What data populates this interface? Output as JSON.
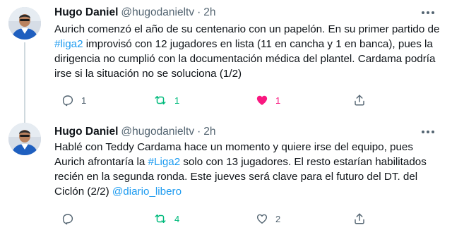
{
  "tweets": [
    {
      "name": "Hugo Daniel",
      "handle": "@hugodanieltv",
      "separator": "·",
      "time": "2h",
      "text_parts": {
        "p1": "Aurich comenzó el año de su centenario con un papelón. En su primer partido de ",
        "link1": "#liga2",
        "p2": " improvisó con 12 jugadores en lista (11 en cancha y 1 en banca), pues la dirigencia no cumplió con la documentación médica del plantel. Cardama podría irse si la situación no se soluciona (1/2)"
      },
      "replies": "1",
      "retweets": "1",
      "likes": "1",
      "liked": true
    },
    {
      "name": "Hugo Daniel",
      "handle": "@hugodanieltv",
      "separator": "·",
      "time": "2h",
      "text_parts": {
        "p1": "Hablé con Teddy Cardama hace un momento y quiere irse del equipo, pues Aurich afrontaría la ",
        "link1": "#Liga2",
        "p2": " solo con 13 jugadores. El resto estarían habilitados recién en la segunda ronda. Este jueves será clave para el futuro del DT. del Ciclón (2/2) ",
        "link2": "@diario_libero"
      },
      "retweets": "4",
      "likes": "2",
      "liked": false
    }
  ],
  "colors": {
    "text": "#0f1419",
    "secondary": "#536471",
    "link": "#1d9bf0",
    "retweet_active": "#00ba7c",
    "like_active": "#f91880",
    "thread_line": "#cfd9de"
  },
  "icons": {
    "more": "more-icon",
    "reply": "reply-icon",
    "retweet": "retweet-icon",
    "like": "heart-icon",
    "share": "share-icon"
  }
}
